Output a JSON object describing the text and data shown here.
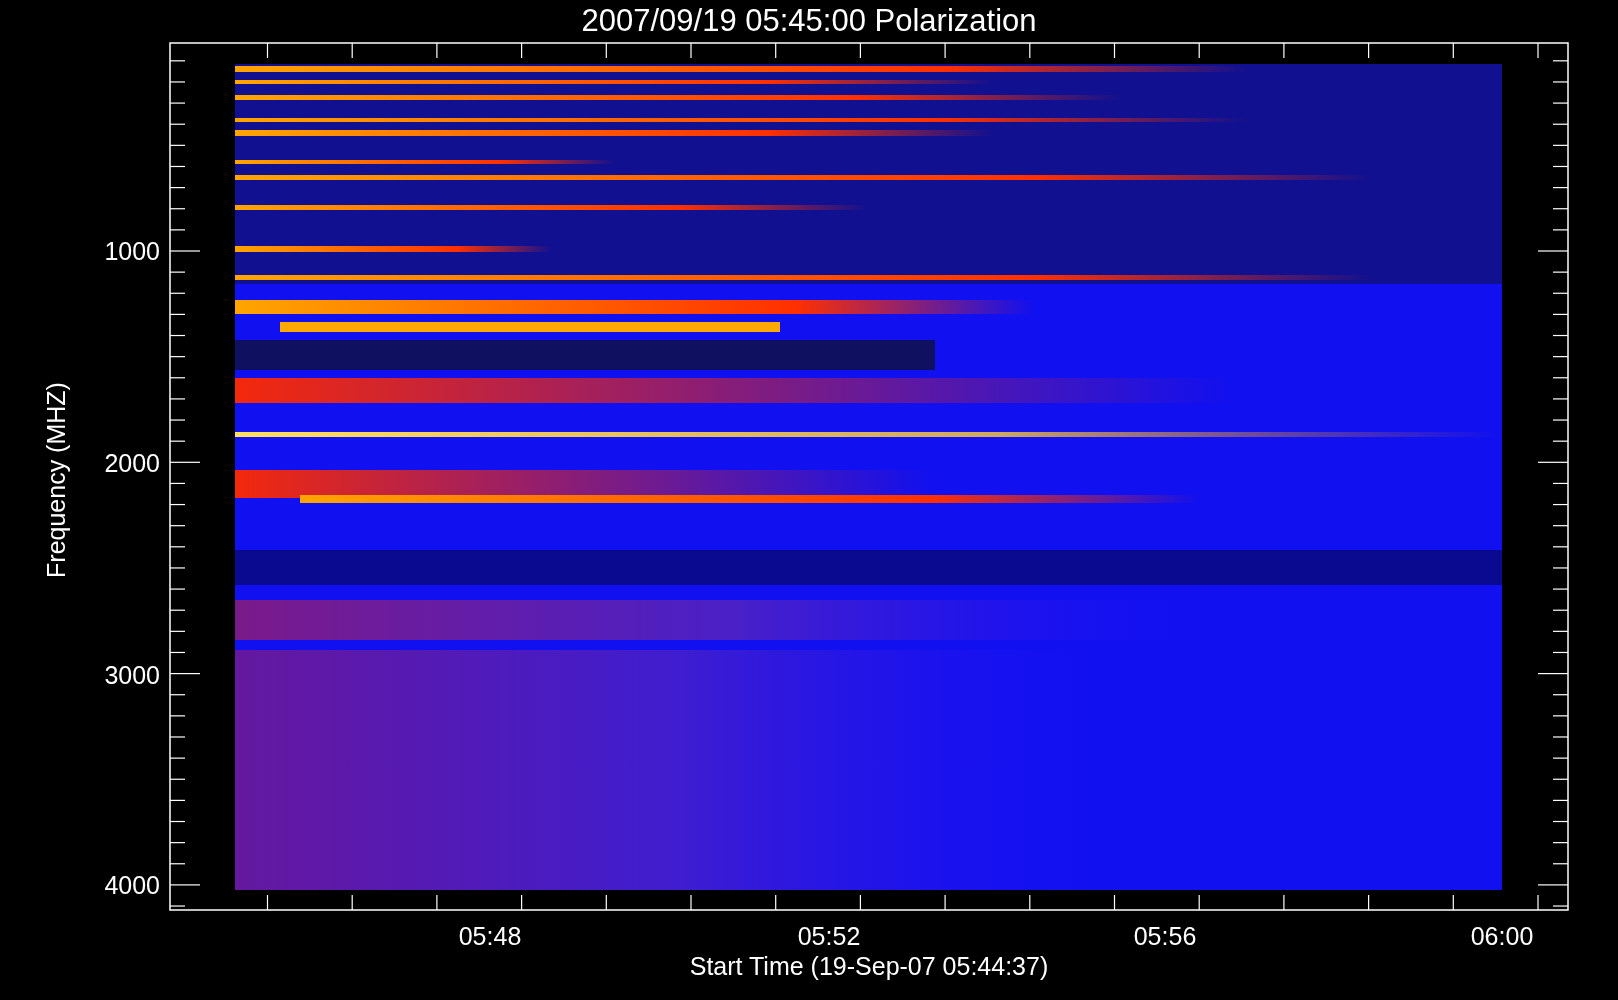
{
  "title": "2007/09/19 05:45:00 Polarization",
  "y_axis": {
    "label": "Frequency (MHZ)",
    "ticks": [
      "1000",
      "2000",
      "3000",
      "4000"
    ]
  },
  "x_axis": {
    "label": "Start Time (19-Sep-07 05:44:37)",
    "ticks": [
      "05:48",
      "05:52",
      "05:56",
      "06:00"
    ]
  }
}
